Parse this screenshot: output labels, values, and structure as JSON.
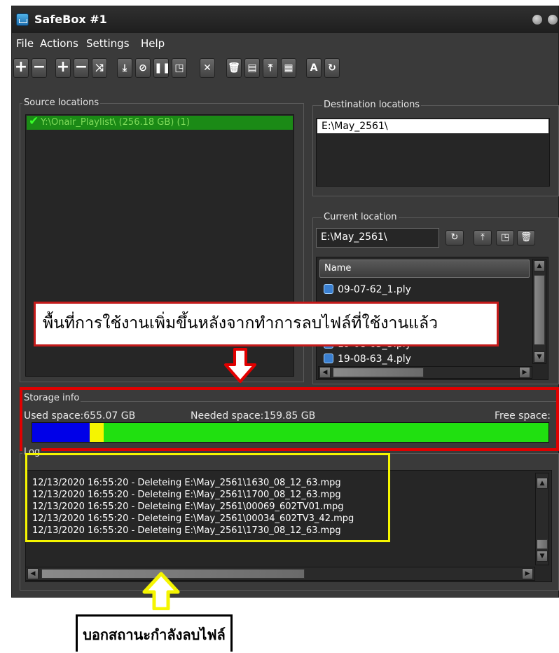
{
  "window": {
    "title": "SafeBox #1"
  },
  "menu": [
    "File",
    "Actions",
    "Settings",
    "Help"
  ],
  "toolbar": {
    "buttons": [
      {
        "name": "add-source",
        "glyph": "+"
      },
      {
        "name": "remove-source",
        "glyph": "−"
      },
      {
        "name": "add-destination",
        "glyph": "+"
      },
      {
        "name": "remove-destination",
        "glyph": "−"
      },
      {
        "name": "shuffle",
        "glyph": "⤨"
      },
      {
        "name": "download",
        "glyph": "⤓"
      },
      {
        "name": "stop",
        "glyph": "⊘"
      },
      {
        "name": "pause",
        "glyph": "❚❚"
      },
      {
        "name": "window",
        "glyph": "◳"
      },
      {
        "name": "tools",
        "glyph": "✕"
      },
      {
        "name": "delete",
        "glyph": "🗑"
      },
      {
        "name": "document",
        "glyph": "▤"
      },
      {
        "name": "upload",
        "glyph": "⤒"
      },
      {
        "name": "grid",
        "glyph": "▦"
      },
      {
        "name": "font",
        "glyph": "A"
      },
      {
        "name": "refresh",
        "glyph": "↻"
      }
    ]
  },
  "source": {
    "legend": "Source locations",
    "items": [
      {
        "label": "Y:\\Onair_Playlist\\ (256.18 GB) (1)"
      }
    ]
  },
  "destination": {
    "legend": "Destination locations",
    "items": [
      {
        "label": "E:\\May_2561\\"
      }
    ]
  },
  "current": {
    "legend": "Current location",
    "path": "E:\\May_2561\\",
    "column_header": "Name",
    "files": [
      "09-07-62_1.ply",
      "19-08-63_3.ply",
      "19-08-63_4.ply"
    ],
    "buttons": [
      {
        "name": "refresh",
        "glyph": "↻"
      },
      {
        "name": "upload",
        "glyph": "⤒"
      },
      {
        "name": "window",
        "glyph": "◳"
      },
      {
        "name": "delete",
        "glyph": "🗑"
      }
    ]
  },
  "storage": {
    "legend": "Storage info",
    "used_label": "Used space:655.07 GB",
    "needed_label": "Needed space:159.85 GB",
    "free_label": "Free space:",
    "bar": {
      "used_fraction": 0.111,
      "needed_fraction": 0.027,
      "used_color": "#0000e8",
      "needed_color": "#f5f500",
      "free_color": "#20e010"
    }
  },
  "log": {
    "legend": "Log",
    "lines": [
      "12/13/2020 16:55:20 - Deleteing E:\\May_2561\\1630_08_12_63.mpg",
      "12/13/2020 16:55:20 - Deleteing E:\\May_2561\\1700_08_12_63.mpg",
      "12/13/2020 16:55:20 - Deleteing E:\\May_2561\\00069_602TV01.mpg",
      "12/13/2020 16:55:20 - Deleteing E:\\May_2561\\00034_602TV3_42.mpg",
      "12/13/2020 16:55:20 - Deleteing E:\\May_2561\\1730_08_12_63.mpg"
    ]
  },
  "annotations": {
    "storage_callout": "พื้นที่การใช้งานเพิ่มขึ้นหลังจากทำการลบไฟล์ที่ใช้งานแล้ว",
    "log_callout": "บอกสถานะกำลังลบไฟล์",
    "highlight_red": "#e10000",
    "highlight_yellow": "#f5f500"
  }
}
